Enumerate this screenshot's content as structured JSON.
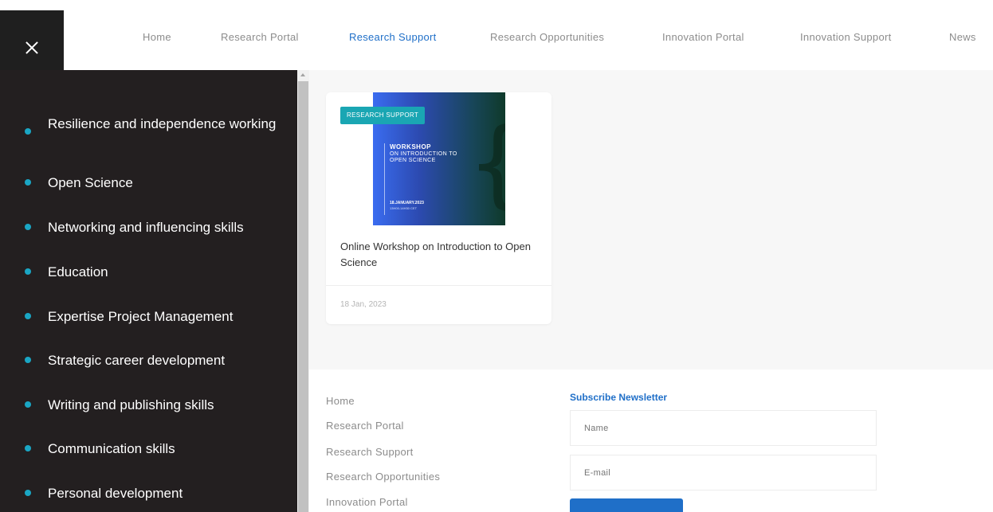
{
  "nav": {
    "links": [
      "Home",
      "Research Portal",
      "Research Support",
      "Research Opportunities",
      "Innovation Portal",
      "Innovation Support",
      "News"
    ],
    "active": "Research Support"
  },
  "sidebar": {
    "items": [
      "Resilience and independence working",
      "Open Science",
      "Networking and influencing skills",
      "Education",
      "Expertise Project Management",
      "Strategic career development",
      "Writing and publishing skills",
      "Communication skills",
      "Personal development"
    ]
  },
  "card": {
    "badge": "RESEARCH SUPPORT",
    "image": {
      "heading": "WORKSHOP",
      "subheading": "ON INTRODUCTION TO OPEN SCIENCE",
      "date": "18.JANUARY.2023",
      "time": "13H00-14H30 CET"
    },
    "title": "Online Workshop on Introduction to Open Science",
    "date": "18 Jan, 2023"
  },
  "footer": {
    "links": [
      "Home",
      "Research Portal",
      "Research Support",
      "Research Opportunities",
      "Innovation Portal"
    ],
    "newsletter": {
      "title": "Subscribe Newsletter",
      "name_placeholder": "Name",
      "email_placeholder": "E-mail",
      "button_label": ""
    }
  },
  "colors": {
    "sidebar_bg": "#231f20",
    "accent_blue": "#1f6fc8",
    "bullet_teal": "#1aa6c4",
    "badge_teal": "#1aa6b3"
  }
}
